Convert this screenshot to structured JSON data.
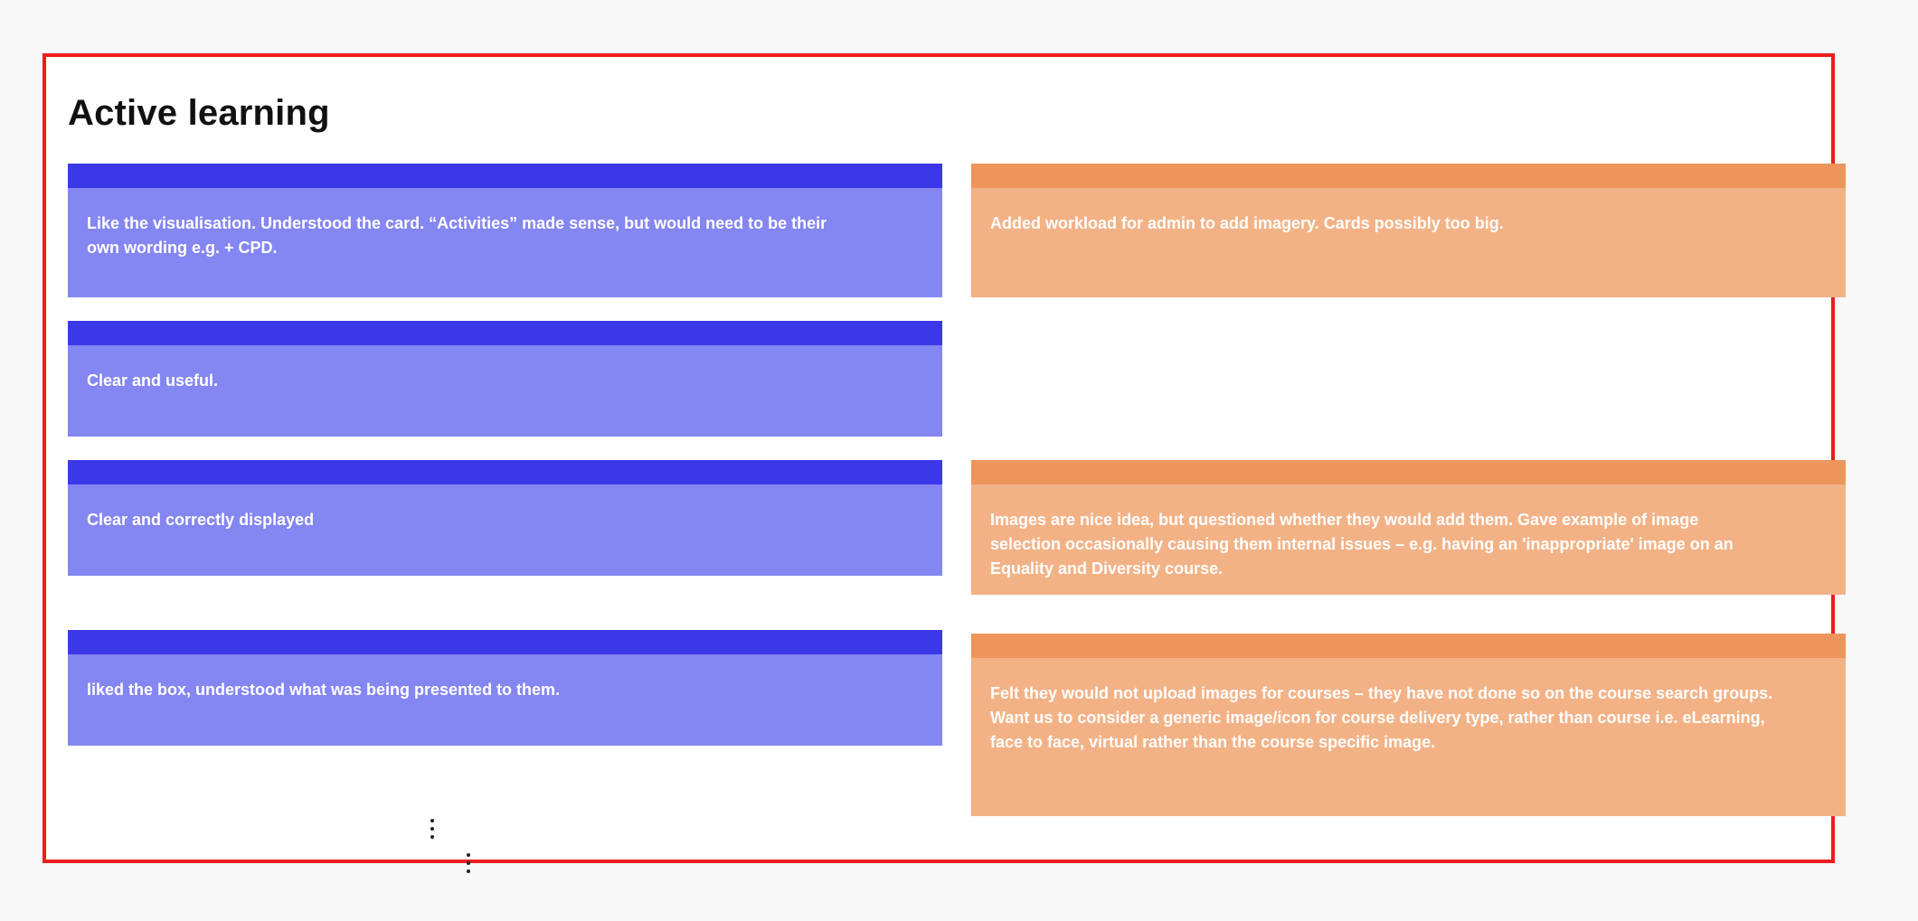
{
  "board": {
    "title": "Active learning"
  },
  "colors": {
    "frame_border": "#ee1c1c",
    "blue_header": "#3b38e8",
    "blue_body": "#8486f2",
    "orange_header": "#ee955c",
    "orange_body": "#f3b286"
  },
  "cards": {
    "left": [
      {
        "text": "Like the visualisation. Understood the card.  “Activities” made sense, but would need to be their own wording e.g. + CPD."
      },
      {
        "text": "Clear and useful."
      },
      {
        "text": "Clear and correctly displayed"
      },
      {
        "text": "liked the box, understood what was being presented to them."
      }
    ],
    "right": [
      {
        "text": "Added workload for admin to add imagery.  Cards possibly too big."
      },
      {
        "text": "Images are nice idea, but questioned whether they would add them. Gave example of image selection occasionally causing them internal issues – e.g. having an 'inappropriate' image on an Equality and Diversity course."
      },
      {
        "text": "Felt they would not upload images for courses – they have not done so on the course search groups. Want us to consider a generic image/icon for course delivery type, rather than course i.e. eLearning, face to face, virtual rather than the course specific image."
      }
    ]
  },
  "icons": {
    "more_menu": "kebab-vertical-icon"
  }
}
